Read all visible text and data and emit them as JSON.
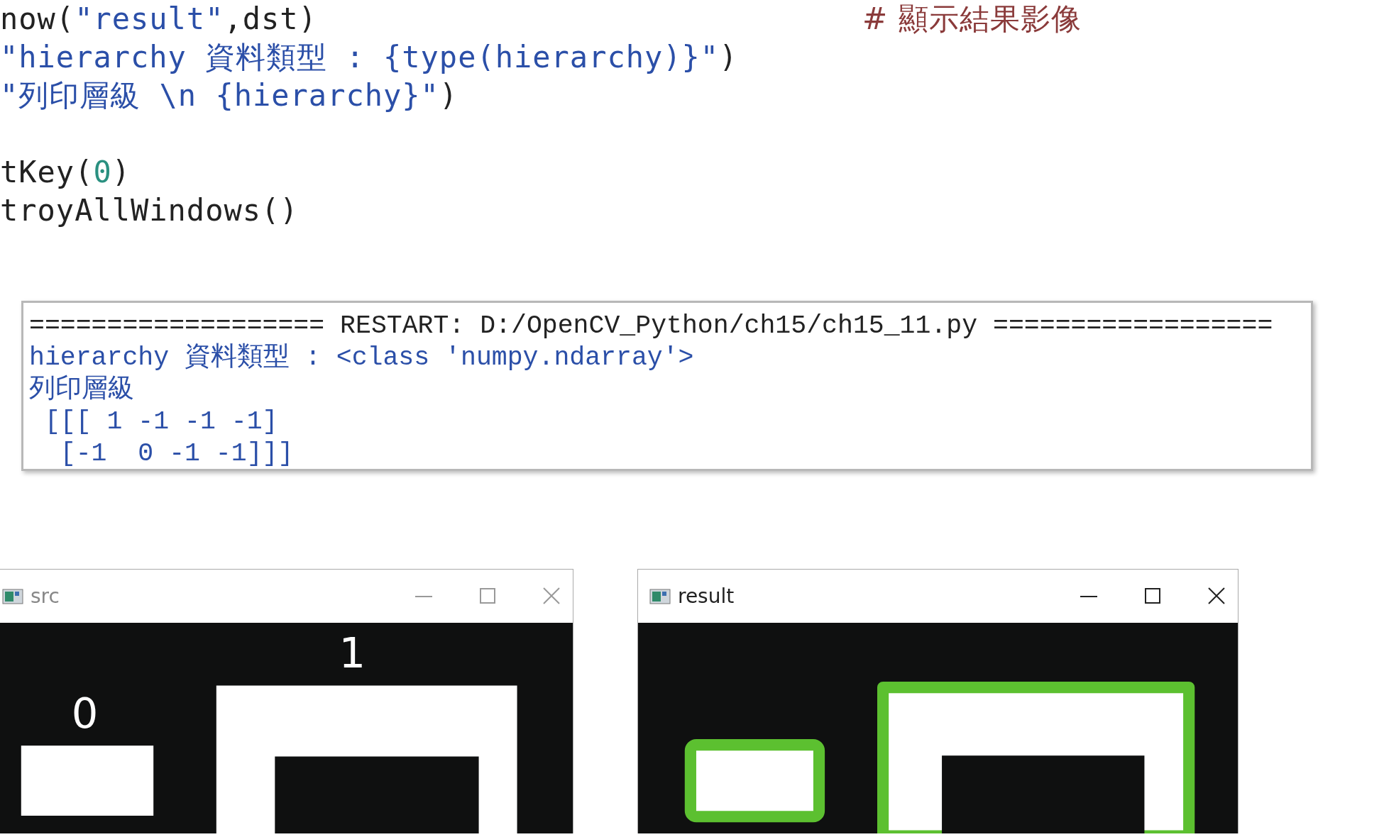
{
  "code_blocks": [
    {
      "lines": [
        {
          "segments": [
            {
              "kind": "plain",
              "text": "now("
            },
            {
              "kind": "string",
              "text": "\"result\""
            },
            {
              "kind": "plain",
              "text": ",dst)"
            }
          ],
          "comment": "# 顯示結果影像"
        },
        {
          "segments": [
            {
              "kind": "string",
              "text": "\"hierarchy 資料類型 : {type(hierarchy)}\""
            },
            {
              "kind": "plain",
              "text": ")"
            }
          ]
        },
        {
          "segments": [
            {
              "kind": "string",
              "text": "\"列印層級 \\n {hierarchy}\""
            },
            {
              "kind": "plain",
              "text": ")"
            }
          ]
        }
      ]
    },
    {
      "lines": [
        {
          "segments": [
            {
              "kind": "plain",
              "text": "tKey("
            },
            {
              "kind": "number",
              "text": "0"
            },
            {
              "kind": "plain",
              "text": ")"
            }
          ]
        },
        {
          "segments": [
            {
              "kind": "plain",
              "text": "troyAllWindows()"
            }
          ]
        }
      ]
    }
  ],
  "shell_output": [
    {
      "kind": "banner",
      "text": "=================== RESTART: D:/OpenCV_Python/ch15/ch15_11.py =================="
    },
    {
      "kind": "output",
      "text": "hierarchy 資料類型 : <class 'numpy.ndarray'>"
    },
    {
      "kind": "output",
      "text": "列印層級"
    },
    {
      "kind": "output",
      "text": " [[[ 1 -1 -1 -1]"
    },
    {
      "kind": "output",
      "text": "  [-1  0 -1 -1]]]"
    }
  ],
  "windows": [
    {
      "title": "src",
      "active": false,
      "kind": "source",
      "labels": [
        "0",
        "1"
      ]
    },
    {
      "title": "result",
      "active": true,
      "kind": "contours",
      "color": "#5cc030"
    }
  ]
}
